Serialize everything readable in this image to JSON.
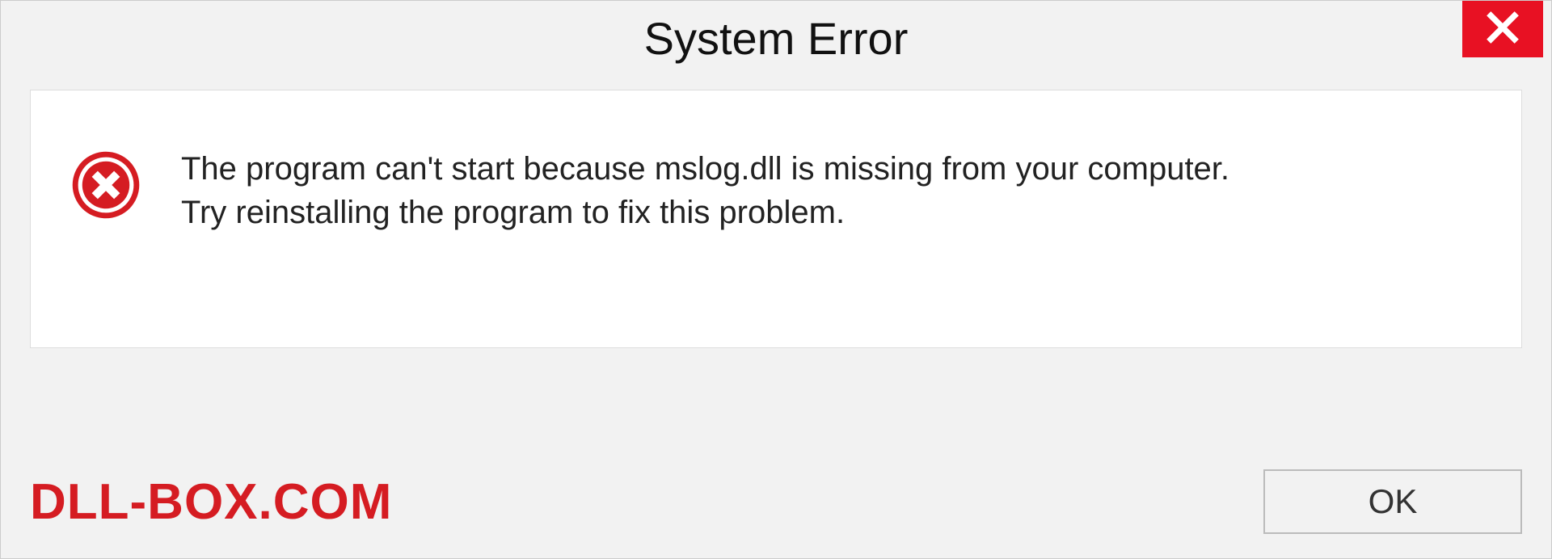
{
  "titlebar": {
    "title": "System Error"
  },
  "message": {
    "line1": "The program can't start because mslog.dll is missing from your computer.",
    "line2": "Try reinstalling the program to fix this problem."
  },
  "footer": {
    "watermark": "DLL-BOX.COM",
    "ok_label": "OK"
  },
  "colors": {
    "close_bg": "#e81123",
    "error_red": "#d51c22"
  }
}
